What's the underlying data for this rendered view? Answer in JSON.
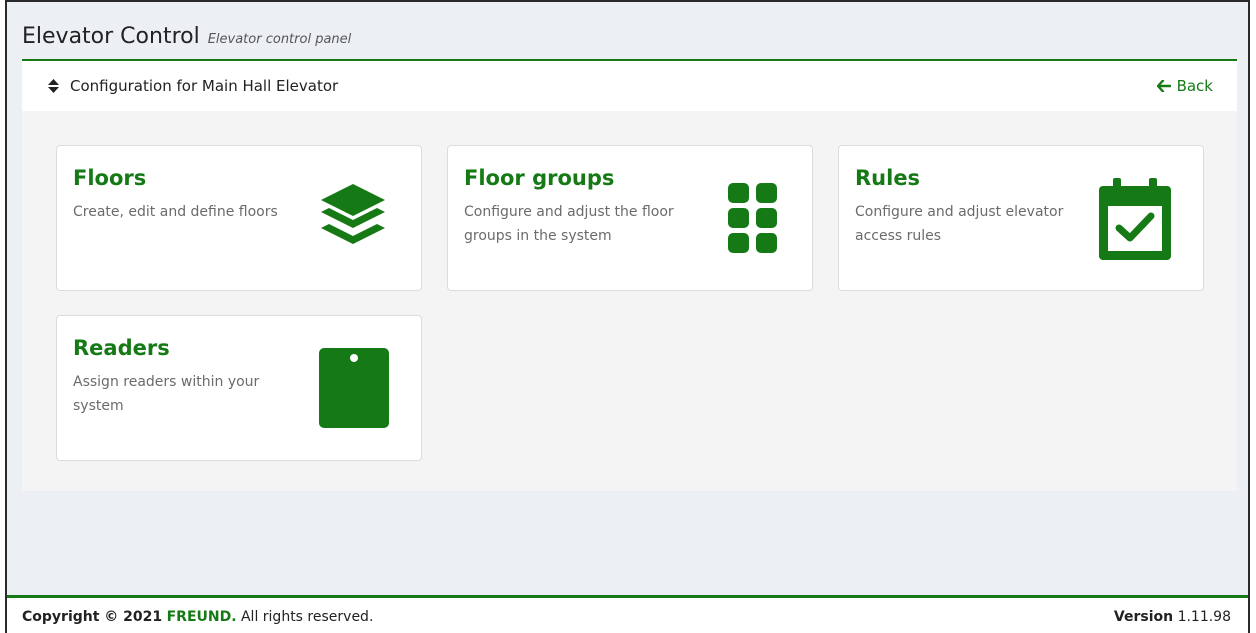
{
  "app": {
    "title": "Elevator Control",
    "subtitle": "Elevator control panel"
  },
  "panel": {
    "title": "Configuration for Main Hall Elevator",
    "back_label": "Back"
  },
  "cards": [
    {
      "title": "Floors",
      "description": "Create, edit and define floors",
      "icon": "layer-group-icon"
    },
    {
      "title": "Floor groups",
      "description": "Configure and adjust the floor groups in the system",
      "icon": "grid-icon"
    },
    {
      "title": "Rules",
      "description": "Configure and adjust elevator access rules",
      "icon": "calendar-check-icon"
    },
    {
      "title": "Readers",
      "description": "Assign readers within your system",
      "icon": "card-reader-icon"
    }
  ],
  "footer": {
    "copyright_prefix": "Copyright © 2021",
    "brand": "FREUND.",
    "copyright_suffix": "All rights reserved.",
    "version_label": "Version",
    "version_value": "1.11.98"
  },
  "colors": {
    "accent": "#157a15",
    "background": "#ecf0f5",
    "panel": "#f4f4f4"
  }
}
